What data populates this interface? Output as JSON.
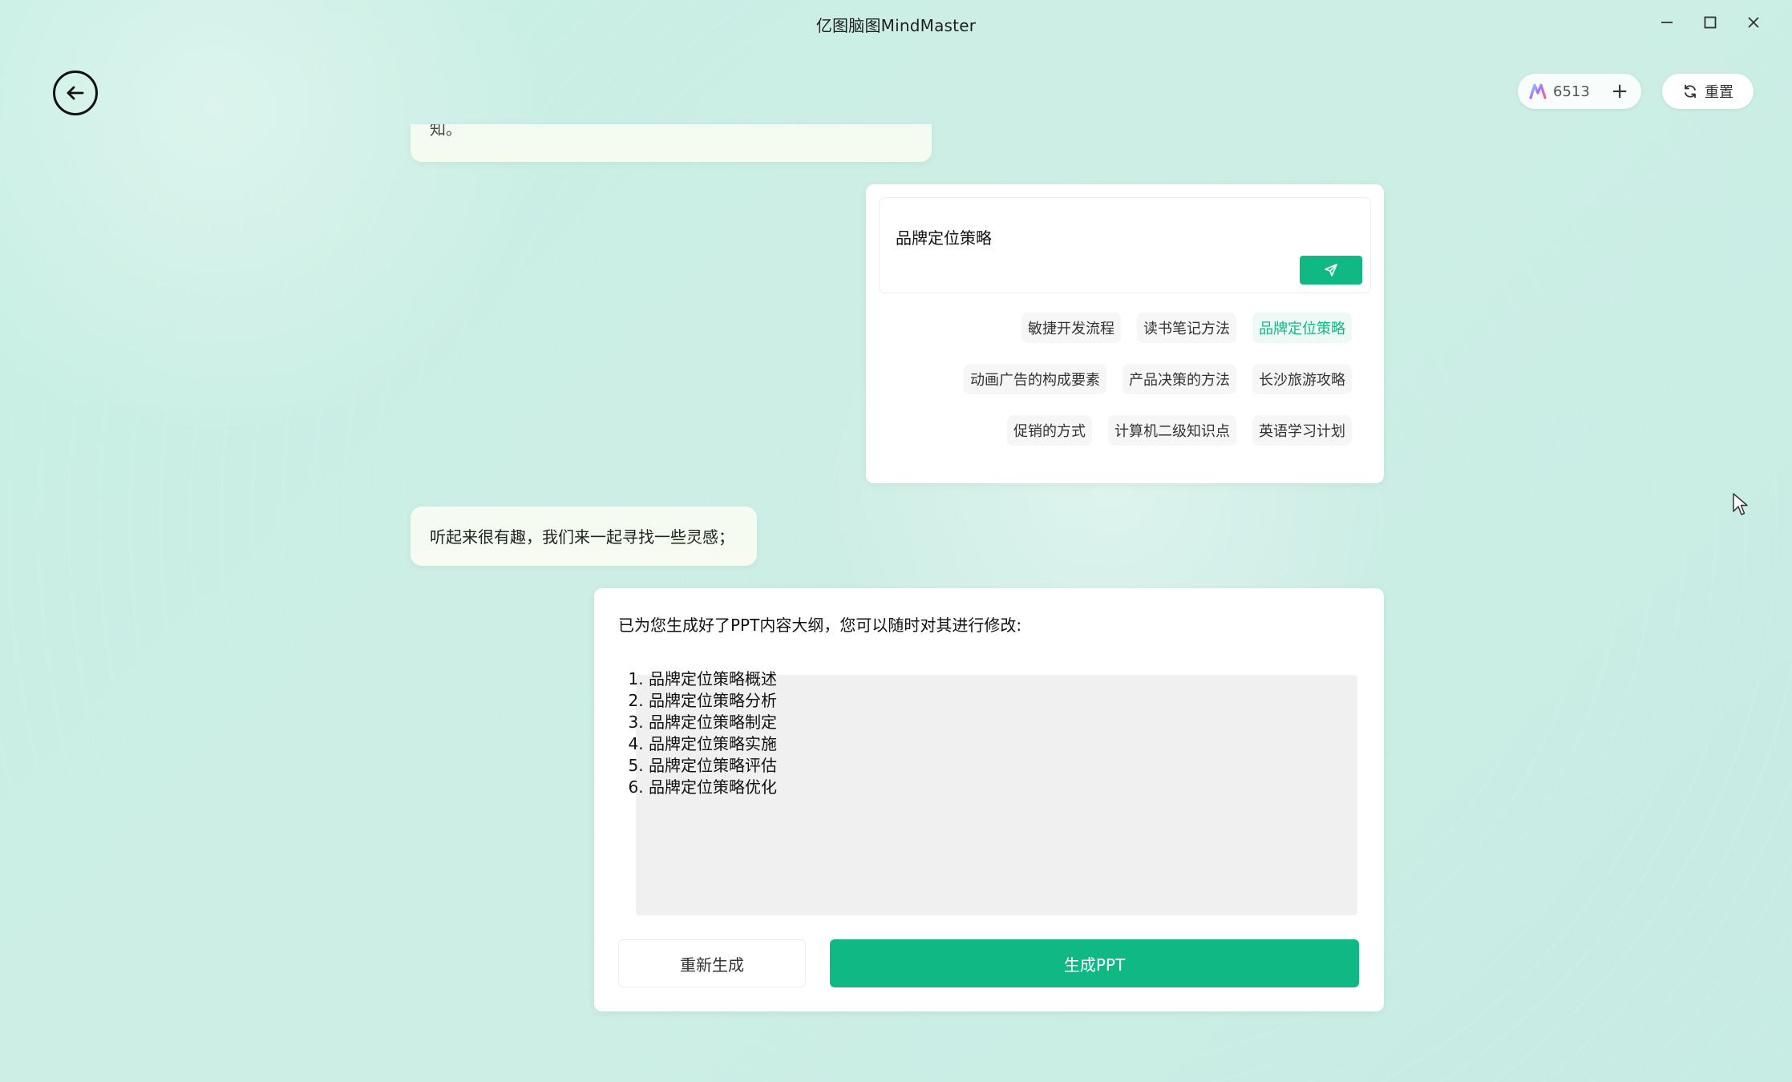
{
  "window": {
    "title": "亿图脑图MindMaster",
    "controls": {
      "minimize_icon": "minimize-icon",
      "maximize_icon": "maximize-icon",
      "close_icon": "close-icon"
    }
  },
  "top_bar": {
    "back_icon": "back-arrow-icon",
    "credits": {
      "count": "6513",
      "plus": "+"
    },
    "reset": {
      "label": "重置",
      "icon": "refresh-icon"
    }
  },
  "chat": {
    "partial_message": "知。",
    "topic_panel": {
      "input_value": "品牌定位策略",
      "send_icon": "send-icon",
      "suggestion_rows": [
        [
          "敏捷开发流程",
          "读书笔记方法",
          "品牌定位策略"
        ],
        [
          "动画广告的构成要素",
          "产品决策的方法",
          "长沙旅游攻略"
        ],
        [
          "促销的方式",
          "计算机二级知识点",
          "英语学习计划"
        ]
      ],
      "active_suggestion": "品牌定位策略"
    },
    "assistant_bubble": "听起来很有趣，我们来一起寻找一些灵感；",
    "outline_panel": {
      "intro": "已为您生成好了PPT内容大纲，您可以随时对其进行修改:",
      "items": [
        "品牌定位策略概述",
        "品牌定位策略分析",
        "品牌定位策略制定",
        "品牌定位策略实施",
        "品牌定位策略评估",
        "品牌定位策略优化"
      ],
      "regen_label": "重新生成",
      "make_ppt_label": "生成PPT"
    }
  },
  "colors": {
    "accent": "#10b884",
    "background": "#c7efe4"
  }
}
